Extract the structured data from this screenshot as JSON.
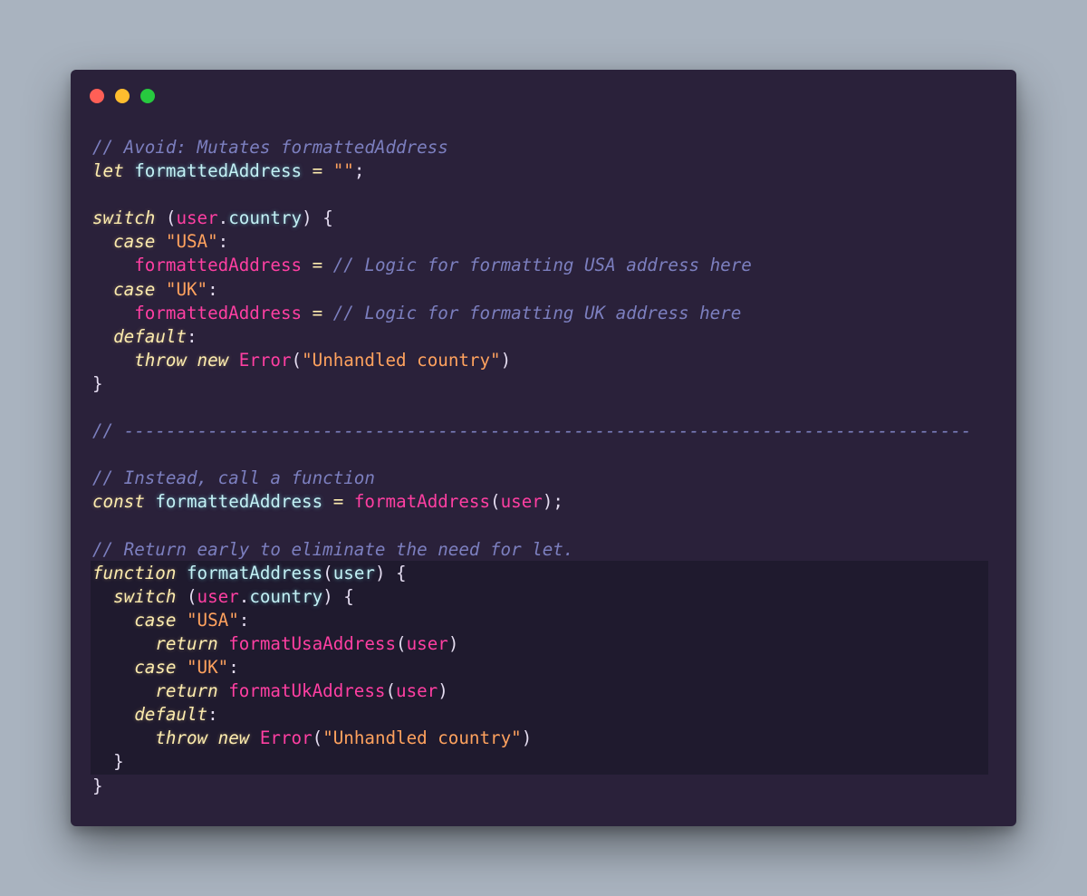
{
  "window": {
    "controls": [
      "close",
      "minimize",
      "maximize"
    ],
    "colors": {
      "background": "#2a213a",
      "page_background": "#a9b3bf",
      "close": "#ff5f56",
      "minimize": "#ffbd2e",
      "maximize": "#27c93f",
      "highlight": "#1f1a2e"
    }
  },
  "code": {
    "language": "javascript",
    "highlighted_lines": [
      19,
      20,
      21,
      22,
      23,
      24,
      25,
      26,
      27,
      28
    ],
    "lines": [
      [
        {
          "t": "comment",
          "v": "// Avoid: Mutates formattedAddress"
        }
      ],
      [
        {
          "t": "keyword",
          "v": "let"
        },
        {
          "t": "plain",
          "v": " "
        },
        {
          "t": "ident",
          "v": "formattedAddress"
        },
        {
          "t": "plain",
          "v": " "
        },
        {
          "t": "op",
          "v": "="
        },
        {
          "t": "plain",
          "v": " "
        },
        {
          "t": "string",
          "v": "\"\""
        },
        {
          "t": "punct",
          "v": ";"
        }
      ],
      [],
      [
        {
          "t": "keyword",
          "v": "switch"
        },
        {
          "t": "plain",
          "v": " "
        },
        {
          "t": "punct",
          "v": "("
        },
        {
          "t": "var",
          "v": "user"
        },
        {
          "t": "punct",
          "v": "."
        },
        {
          "t": "prop",
          "v": "country"
        },
        {
          "t": "punct",
          "v": ") {"
        }
      ],
      [
        {
          "t": "plain",
          "v": "  "
        },
        {
          "t": "keyword",
          "v": "case"
        },
        {
          "t": "plain",
          "v": " "
        },
        {
          "t": "string",
          "v": "\"USA\""
        },
        {
          "t": "punct",
          "v": ":"
        }
      ],
      [
        {
          "t": "plain",
          "v": "    "
        },
        {
          "t": "assigned",
          "v": "formattedAddress"
        },
        {
          "t": "plain",
          "v": " "
        },
        {
          "t": "op",
          "v": "="
        },
        {
          "t": "plain",
          "v": " "
        },
        {
          "t": "comment",
          "v": "// Logic for formatting USA address here"
        }
      ],
      [
        {
          "t": "plain",
          "v": "  "
        },
        {
          "t": "keyword",
          "v": "case"
        },
        {
          "t": "plain",
          "v": " "
        },
        {
          "t": "string",
          "v": "\"UK\""
        },
        {
          "t": "punct",
          "v": ":"
        }
      ],
      [
        {
          "t": "plain",
          "v": "    "
        },
        {
          "t": "assigned",
          "v": "formattedAddress"
        },
        {
          "t": "plain",
          "v": " "
        },
        {
          "t": "op",
          "v": "="
        },
        {
          "t": "plain",
          "v": " "
        },
        {
          "t": "comment",
          "v": "// Logic for formatting UK address here"
        }
      ],
      [
        {
          "t": "plain",
          "v": "  "
        },
        {
          "t": "keyword",
          "v": "default"
        },
        {
          "t": "punct",
          "v": ":"
        }
      ],
      [
        {
          "t": "plain",
          "v": "    "
        },
        {
          "t": "keyword",
          "v": "throw"
        },
        {
          "t": "plain",
          "v": " "
        },
        {
          "t": "keyword",
          "v": "new"
        },
        {
          "t": "plain",
          "v": " "
        },
        {
          "t": "class",
          "v": "Error"
        },
        {
          "t": "punct",
          "v": "("
        },
        {
          "t": "string",
          "v": "\"Unhandled country\""
        },
        {
          "t": "punct",
          "v": ")"
        }
      ],
      [
        {
          "t": "punct",
          "v": "}"
        }
      ],
      [],
      [
        {
          "t": "comment",
          "v": "// ---------------------------------------------------------------------------------"
        }
      ],
      [],
      [
        {
          "t": "comment",
          "v": "// Instead, call a function"
        }
      ],
      [
        {
          "t": "keyword",
          "v": "const"
        },
        {
          "t": "plain",
          "v": " "
        },
        {
          "t": "ident",
          "v": "formattedAddress"
        },
        {
          "t": "plain",
          "v": " "
        },
        {
          "t": "op",
          "v": "="
        },
        {
          "t": "plain",
          "v": " "
        },
        {
          "t": "call",
          "v": "formatAddress"
        },
        {
          "t": "punct",
          "v": "("
        },
        {
          "t": "var",
          "v": "user"
        },
        {
          "t": "punct",
          "v": ");"
        }
      ],
      [],
      [
        {
          "t": "comment",
          "v": "// Return early to eliminate the need for let."
        }
      ],
      [
        {
          "t": "keyword",
          "v": "function"
        },
        {
          "t": "plain",
          "v": " "
        },
        {
          "t": "ident",
          "v": "formatAddress"
        },
        {
          "t": "punct",
          "v": "("
        },
        {
          "t": "ident",
          "v": "user"
        },
        {
          "t": "punct",
          "v": ") {"
        }
      ],
      [
        {
          "t": "plain",
          "v": "  "
        },
        {
          "t": "keyword",
          "v": "switch"
        },
        {
          "t": "plain",
          "v": " "
        },
        {
          "t": "punct",
          "v": "("
        },
        {
          "t": "var",
          "v": "user"
        },
        {
          "t": "punct",
          "v": "."
        },
        {
          "t": "prop",
          "v": "country"
        },
        {
          "t": "punct",
          "v": ") {"
        }
      ],
      [
        {
          "t": "plain",
          "v": "    "
        },
        {
          "t": "keyword",
          "v": "case"
        },
        {
          "t": "plain",
          "v": " "
        },
        {
          "t": "string",
          "v": "\"USA\""
        },
        {
          "t": "punct",
          "v": ":"
        }
      ],
      [
        {
          "t": "plain",
          "v": "      "
        },
        {
          "t": "keyword",
          "v": "return"
        },
        {
          "t": "plain",
          "v": " "
        },
        {
          "t": "call",
          "v": "formatUsaAddress"
        },
        {
          "t": "punct",
          "v": "("
        },
        {
          "t": "var",
          "v": "user"
        },
        {
          "t": "punct",
          "v": ")"
        }
      ],
      [
        {
          "t": "plain",
          "v": "    "
        },
        {
          "t": "keyword",
          "v": "case"
        },
        {
          "t": "plain",
          "v": " "
        },
        {
          "t": "string",
          "v": "\"UK\""
        },
        {
          "t": "punct",
          "v": ":"
        }
      ],
      [
        {
          "t": "plain",
          "v": "      "
        },
        {
          "t": "keyword",
          "v": "return"
        },
        {
          "t": "plain",
          "v": " "
        },
        {
          "t": "call",
          "v": "formatUkAddress"
        },
        {
          "t": "punct",
          "v": "("
        },
        {
          "t": "var",
          "v": "user"
        },
        {
          "t": "punct",
          "v": ")"
        }
      ],
      [
        {
          "t": "plain",
          "v": "    "
        },
        {
          "t": "keyword",
          "v": "default"
        },
        {
          "t": "punct",
          "v": ":"
        }
      ],
      [
        {
          "t": "plain",
          "v": "      "
        },
        {
          "t": "keyword",
          "v": "throw"
        },
        {
          "t": "plain",
          "v": " "
        },
        {
          "t": "keyword",
          "v": "new"
        },
        {
          "t": "plain",
          "v": " "
        },
        {
          "t": "class",
          "v": "Error"
        },
        {
          "t": "punct",
          "v": "("
        },
        {
          "t": "string",
          "v": "\"Unhandled country\""
        },
        {
          "t": "punct",
          "v": ")"
        }
      ],
      [
        {
          "t": "plain",
          "v": "  "
        },
        {
          "t": "punct",
          "v": "}"
        }
      ],
      [
        {
          "t": "punct",
          "v": "}"
        }
      ]
    ]
  }
}
